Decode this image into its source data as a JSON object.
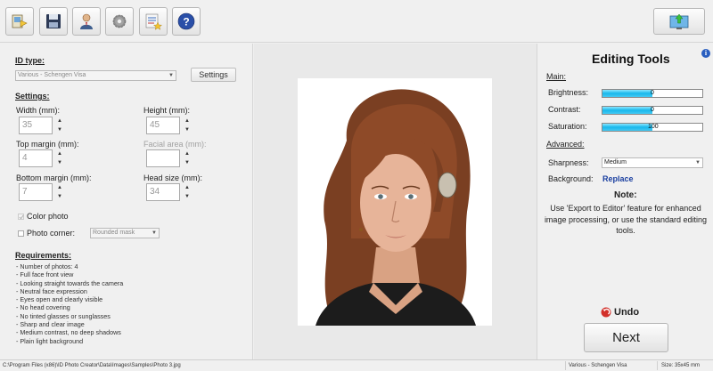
{
  "toolbar": {
    "buttons": [
      {
        "name": "open-image-icon"
      },
      {
        "name": "save-icon"
      },
      {
        "name": "user-icon"
      },
      {
        "name": "gear-icon"
      },
      {
        "name": "favorites-icon"
      },
      {
        "name": "help-icon"
      }
    ],
    "export_icon": "export-monitor-icon"
  },
  "left_panel": {
    "id_type_label": "ID type:",
    "id_type_value": "Various - Schengen Visa",
    "settings_button": "Settings",
    "settings_label": "Settings:",
    "width_label": "Width (mm):",
    "width_value": "35",
    "height_label": "Height (mm):",
    "height_value": "45",
    "top_margin_label": "Top margin (mm):",
    "top_margin_value": "4",
    "facial_area_label": "Facial area (mm):",
    "facial_area_value": "",
    "bottom_margin_label": "Bottom margin (mm):",
    "bottom_margin_value": "7",
    "head_size_label": "Head size (mm):",
    "head_size_value": "34",
    "color_photo_label": "Color photo",
    "color_photo_checked": true,
    "photo_corner_label": "Photo corner:",
    "photo_corner_checked": false,
    "photo_corner_value": "Rounded mask",
    "requirements_label": "Requirements:",
    "requirements": [
      "- Number of photos: 4",
      "- Full face front view",
      "- Looking straight towards the camera",
      "- Neutral face expression",
      "- Eyes open and clearly visible",
      "- No head covering",
      "- No tinted glasses or sunglasses",
      "- Sharp and clear image",
      "- Medium contrast, no deep shadows",
      "- Plain light background"
    ]
  },
  "right_panel": {
    "title": "Editing Tools",
    "main_label": "Main:",
    "brightness_label": "Brightness:",
    "brightness_value": "0",
    "contrast_label": "Contrast:",
    "contrast_value": "0",
    "saturation_label": "Saturation:",
    "saturation_value": "100",
    "advanced_label": "Advanced:",
    "sharpness_label": "Sharpness:",
    "sharpness_value": "Medium",
    "background_label": "Background:",
    "background_link": "Replace",
    "note_title": "Note:",
    "note_text": "Use 'Export to Editor' feature for enhanced image processing, or use the standard editing tools.",
    "undo_label": "Undo",
    "next_label": "Next",
    "info_icon": "info-icon",
    "accent_color": "#18b8ec",
    "link_color": "#1a3fa0"
  },
  "status_bar": {
    "path": "C:\\Program Files (x86)\\ID Photo Creator\\Data\\Images\\Samples\\Photo 3.jpg",
    "id_type": "Various - Schengen Visa",
    "size": "Size: 35x45 mm"
  }
}
